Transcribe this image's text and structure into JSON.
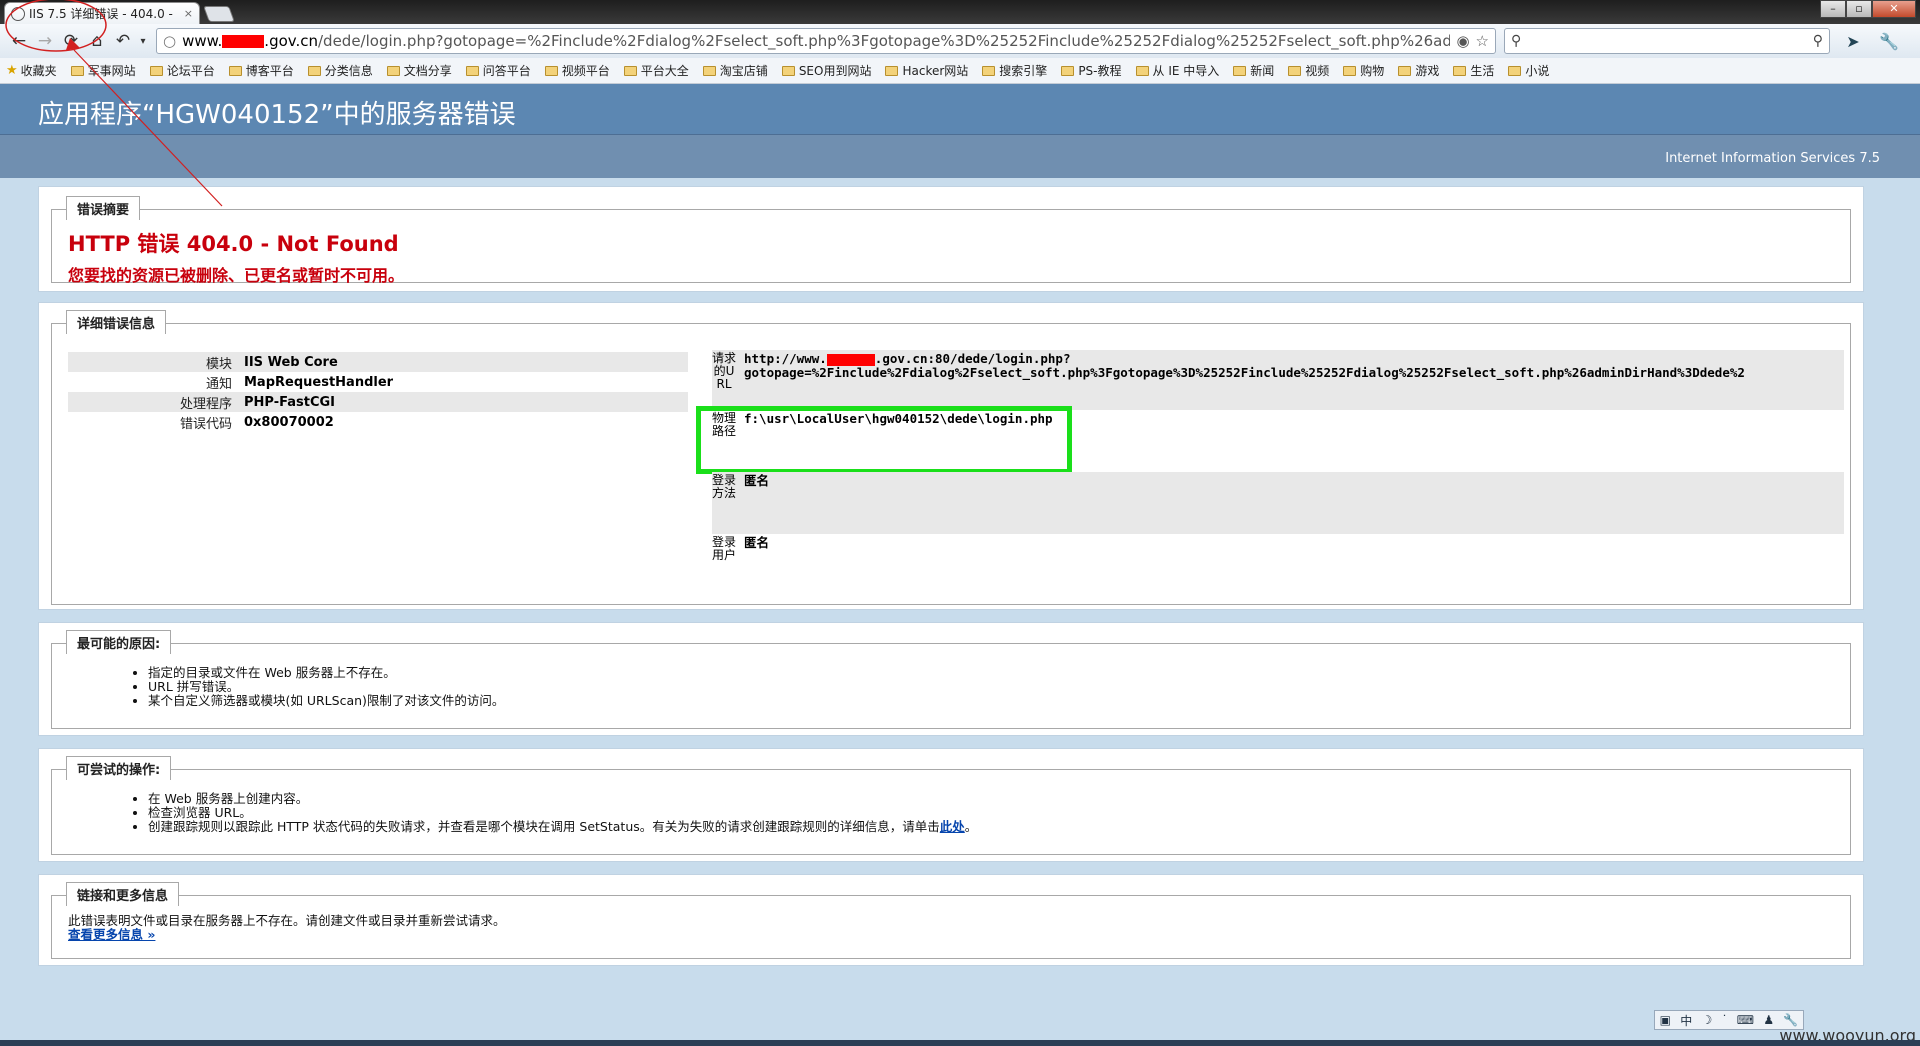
{
  "browser": {
    "tab_title": "IIS 7.5 详细错误 - 404.0 -",
    "tab_close": "×",
    "url_host_prefix": "www.",
    "url_host_suffix": ".gov.cn",
    "url_path": "/dede/login.php?gotopage=%2Finclude%2Fdialog%2Fselect_soft.php%3Fgotopage%3D%25252Finclude%25252Fdialog%25252Fselect_soft.php%26adm",
    "window_controls": [
      "–",
      "▫",
      "✕"
    ],
    "bookmarks_root": "收藏夹",
    "bookmarks": [
      "军事网站",
      "论坛平台",
      "博客平台",
      "分类信息",
      "文档分享",
      "问答平台",
      "视频平台",
      "平台大全",
      "淘宝店铺",
      "SEO用到网站",
      "Hacker网站",
      "搜索引擎",
      "PS-教程",
      "从 IE 中导入",
      "新闻",
      "视频",
      "购物",
      "游戏",
      "生活",
      "小说"
    ]
  },
  "iis": {
    "header_title": "应用程序“HGW040152”中的服务器错误",
    "product": "Internet Information Services 7.5",
    "summary": {
      "legend": "错误摘要",
      "title": "HTTP 错误 404.0 - Not Found",
      "description": "您要找的资源已被删除、已更名或暂时不可用。"
    },
    "details": {
      "legend": "详细错误信息",
      "left": [
        {
          "k": "模块",
          "v": "IIS Web Core"
        },
        {
          "k": "通知",
          "v": "MapRequestHandler"
        },
        {
          "k": "处理程序",
          "v": "PHP-FastCGI"
        },
        {
          "k": "错误代码",
          "v": "0x80070002"
        }
      ],
      "request_url_label": "请求的URL",
      "request_url_line1_prefix": "http://www.",
      "request_url_line1_suffix": ".gov.cn:80/dede/login.php?",
      "request_url_line2": "gotopage=%2Finclude%2Fdialog%2Fselect_soft.php%3Fgotopage%3D%25252Finclude%25252Fdialog%25252Fselect_soft.php%26adminDirHand%3Ddede%2",
      "physical_path_label": "物理路径",
      "physical_path": "f:\\usr\\LocalUser\\hgw040152\\dede\\login.php",
      "logon_method_label": "登录方法",
      "logon_method": "匿名",
      "logon_user_label": "登录用户",
      "logon_user": "匿名"
    },
    "causes": {
      "legend": "最可能的原因:",
      "items": [
        "指定的目录或文件在 Web 服务器上不存在。",
        "URL 拼写错误。",
        "某个自定义筛选器或模块(如 URLScan)限制了对该文件的访问。"
      ]
    },
    "actions": {
      "legend": "可尝试的操作:",
      "items": [
        "在 Web 服务器上创建内容。",
        "检查浏览器 URL。"
      ],
      "item3_text": "创建跟踪规则以跟踪此 HTTP 状态代码的失败请求，并查看是哪个模块在调用 SetStatus。有关为失败的请求创建跟踪规则的详细信息，请单击",
      "item3_link": "此处",
      "item3_end": "。"
    },
    "links": {
      "legend": "链接和更多信息",
      "text": "此错误表明文件或目录在服务器上不存在。请创建文件或目录并重新尝试请求。",
      "more": "查看更多信息 »"
    }
  },
  "ime_bar": "中",
  "watermark": "www.wooyun.org",
  "colors": {
    "header": "#5c87b2",
    "error_red": "#c8000c",
    "highlight_green": "#1adf1a",
    "annotation_red": "#d22020"
  }
}
